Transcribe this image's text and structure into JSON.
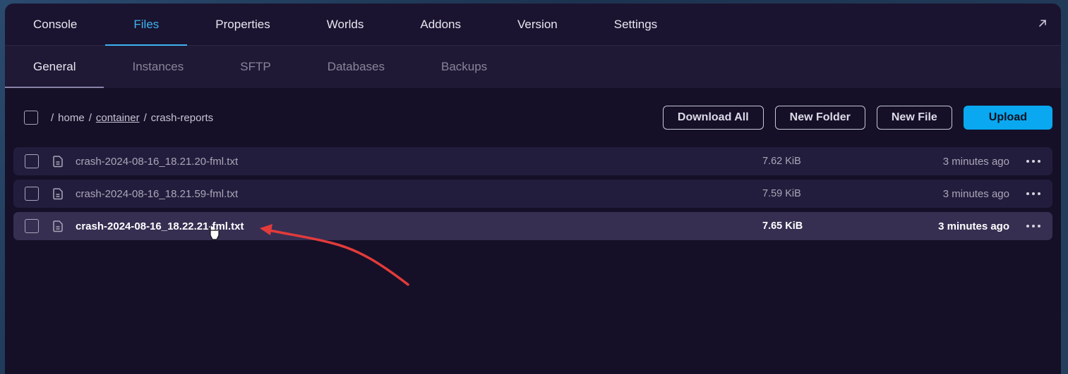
{
  "top_tabs": [
    "Console",
    "Files",
    "Properties",
    "Worlds",
    "Addons",
    "Version",
    "Settings"
  ],
  "active_top_tab": "Files",
  "sub_tabs": [
    "General",
    "Instances",
    "SFTP",
    "Databases",
    "Backups"
  ],
  "active_sub_tab": "General",
  "breadcrumb": {
    "root": "/",
    "p1": "home",
    "p2": "container",
    "p3": "crash-reports"
  },
  "actions": {
    "download_all": "Download All",
    "new_folder": "New Folder",
    "new_file": "New File",
    "upload": "Upload"
  },
  "files": [
    {
      "name": "crash-2024-08-16_18.21.20-fml.txt",
      "size": "7.62 KiB",
      "modified": "3 minutes ago"
    },
    {
      "name": "crash-2024-08-16_18.21.59-fml.txt",
      "size": "7.59 KiB",
      "modified": "3 minutes ago"
    },
    {
      "name": "crash-2024-08-16_18.22.21-fml.txt",
      "size": "7.65 KiB",
      "modified": "3 minutes ago"
    }
  ],
  "colors": {
    "accent": "#3fb4f0",
    "upload": "#0aa8f0",
    "annotation": "#e23b3b"
  },
  "icons": [
    "popout-icon",
    "file-icon",
    "more-icon",
    "cursor-hand-icon",
    "annotation-arrow"
  ]
}
